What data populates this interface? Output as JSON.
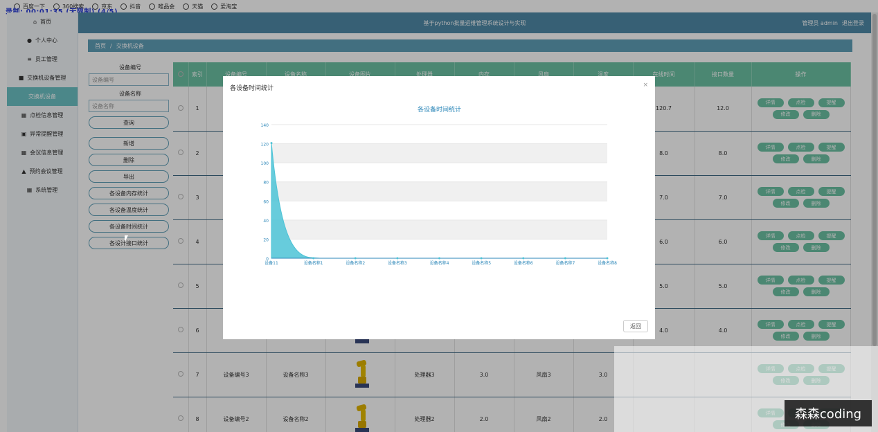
{
  "browser": {
    "bookmarks": [
      "百度一下",
      "360搜索",
      "京东",
      "抖音",
      "唯品会",
      "天猫",
      "爱淘宝"
    ],
    "recording_overlay": "录制: 00:01:35 (无限制) (4/5)"
  },
  "header": {
    "title": "基于python批量运维管理系统设计与实现",
    "user": "管理员 admin",
    "logout": "退出登录"
  },
  "breadcrumb": {
    "home": "首页",
    "sep": "/",
    "current": "交换机设备"
  },
  "sidebar": {
    "items": [
      {
        "label": "首页",
        "icon": "home-icon",
        "glyph": "⌂"
      },
      {
        "label": "个人中心",
        "icon": "user-icon",
        "glyph": "●"
      },
      {
        "label": "员工管理",
        "icon": "list-icon",
        "glyph": "≡"
      },
      {
        "label": "交换机设备管理",
        "icon": "chat-icon",
        "glyph": "■"
      },
      {
        "label": "交换机设备",
        "icon": "",
        "glyph": ""
      },
      {
        "label": "点检信息管理",
        "icon": "grid-icon",
        "glyph": "▦"
      },
      {
        "label": "异常提醒管理",
        "icon": "alert-icon",
        "glyph": "▣"
      },
      {
        "label": "会议信息管理",
        "icon": "grid-icon",
        "glyph": "▦"
      },
      {
        "label": "预约会议管理",
        "icon": "user-icon",
        "glyph": "▲"
      },
      {
        "label": "系统管理",
        "icon": "grid-icon",
        "glyph": "▦"
      }
    ]
  },
  "search": {
    "code_label": "设备编号",
    "code_placeholder": "设备编号",
    "name_label": "设备名称",
    "name_placeholder": "设备名称",
    "search_btn": "查询",
    "add_btn": "新增",
    "delete_btn": "删除",
    "export_btn": "导出",
    "stat_memory": "各设备内存统计",
    "stat_temp": "各设备温度统计",
    "stat_time": "各设备时间统计",
    "stat_port": "各设计接口统计"
  },
  "table": {
    "headers": [
      "",
      "索引",
      "设备编号",
      "设备名称",
      "设备图片",
      "处理器",
      "内存",
      "风扇",
      "温度",
      "在线时间",
      "接口数量",
      "操作"
    ],
    "rows": [
      {
        "idx": "1",
        "code": "",
        "name": "",
        "cpu": "",
        "mem": "",
        "fan": "",
        "temp": "",
        "time": "120.7",
        "ports": "12.0"
      },
      {
        "idx": "2",
        "code": "",
        "name": "",
        "cpu": "",
        "mem": "",
        "fan": "",
        "temp": "",
        "time": "8.0",
        "ports": "8.0"
      },
      {
        "idx": "3",
        "code": "",
        "name": "",
        "cpu": "",
        "mem": "",
        "fan": "",
        "temp": "",
        "time": "7.0",
        "ports": "7.0"
      },
      {
        "idx": "4",
        "code": "",
        "name": "",
        "cpu": "",
        "mem": "",
        "fan": "",
        "temp": "",
        "time": "6.0",
        "ports": "6.0"
      },
      {
        "idx": "5",
        "code": "",
        "name": "",
        "cpu": "",
        "mem": "",
        "fan": "",
        "temp": "",
        "time": "5.0",
        "ports": "5.0"
      },
      {
        "idx": "6",
        "code": "",
        "name": "",
        "cpu": "",
        "mem": "",
        "fan": "",
        "temp": "",
        "time": "4.0",
        "ports": "4.0"
      },
      {
        "idx": "7",
        "code": "设备编号3",
        "name": "设备名称3",
        "cpu": "处理器3",
        "mem": "3.0",
        "fan": "风扇3",
        "temp": "3.0",
        "time": "",
        "ports": ""
      },
      {
        "idx": "8",
        "code": "设备编号2",
        "name": "设备名称2",
        "cpu": "处理器2",
        "mem": "2.0",
        "fan": "风扇2",
        "temp": "2.0",
        "time": "",
        "ports": ""
      }
    ],
    "ops": [
      "详情",
      "点检",
      "提醒",
      "修改",
      "删除"
    ]
  },
  "modal": {
    "title": "各设备时间统计",
    "close": "×",
    "back_btn": "返回"
  },
  "chart_data": {
    "type": "area",
    "title": "各设备时间统计",
    "categories": [
      "设备11",
      "设备名称1",
      "设备名称2",
      "设备名称3",
      "设备名称4",
      "设备名称5",
      "设备名称6",
      "设备名称7",
      "设备名称8"
    ],
    "values": [
      120.7,
      8.0,
      7.0,
      6.0,
      5.0,
      4.0,
      3.0,
      2.0,
      1.0
    ],
    "ylim": [
      0,
      140
    ],
    "yticks": [
      0,
      20,
      40,
      60,
      80,
      100,
      120,
      140
    ],
    "color": "#4cc3d6",
    "grid": true
  },
  "watermark": "森森coding"
}
